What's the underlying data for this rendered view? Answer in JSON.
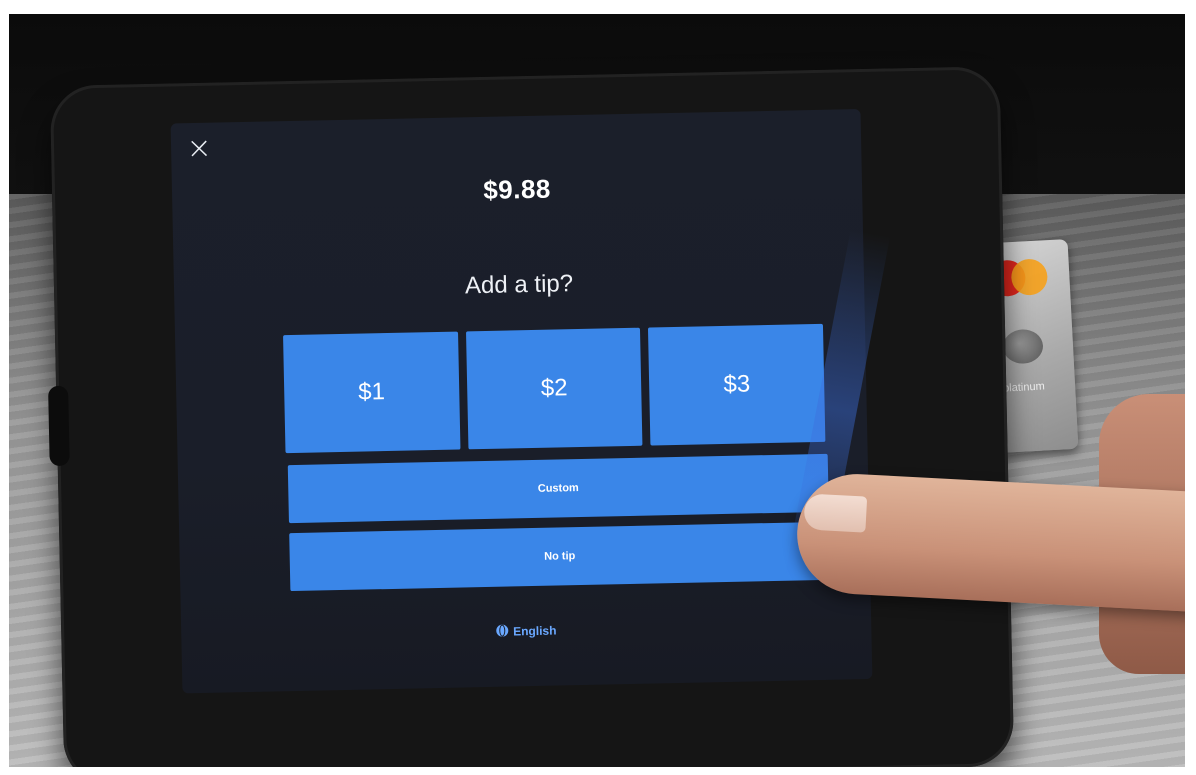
{
  "screen": {
    "close_symbol": "×",
    "amount": "$9.88",
    "prompt": "Add a tip?",
    "tip_options": [
      {
        "label": "$1"
      },
      {
        "label": "$2"
      },
      {
        "label": "$3"
      }
    ],
    "custom_label": "Custom",
    "no_tip_label": "No tip",
    "language_label": "English"
  },
  "card": {
    "brand": "platinum"
  },
  "colors": {
    "button": "#3a86e8",
    "screen_bg": "#1b1f2a",
    "language_link": "#6aa8ff"
  },
  "icons": {
    "close": "close-icon",
    "language": "globe-icon"
  }
}
